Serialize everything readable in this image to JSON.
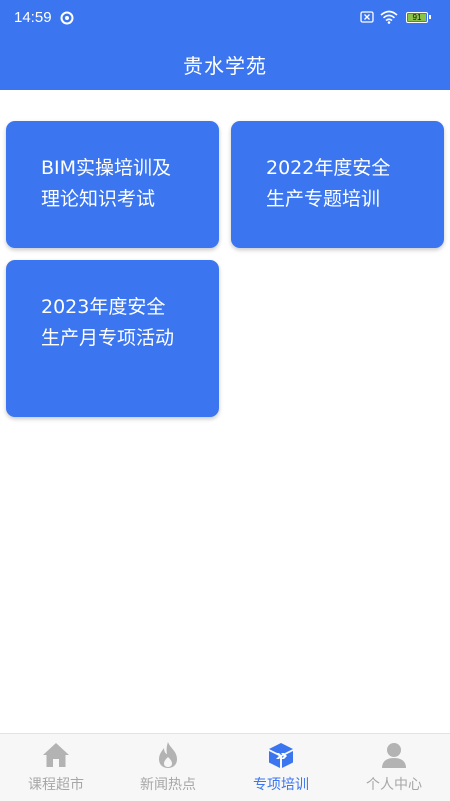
{
  "status_bar": {
    "time": "14:59",
    "battery": "91",
    "icons": [
      "sync-icon",
      "sim-off-icon",
      "wifi-icon",
      "battery-icon"
    ]
  },
  "header": {
    "title": "贵水学苑"
  },
  "cards": [
    {
      "label": "BIM实操培训及理论知识考试"
    },
    {
      "label": "2022年度安全生产专题培训"
    },
    {
      "label": "2023年度安全生产月专项活动"
    }
  ],
  "bottom_nav": [
    {
      "label": "课程超市",
      "icon": "home-icon",
      "active": false
    },
    {
      "label": "新闻热点",
      "icon": "flame-icon",
      "active": false
    },
    {
      "label": "专项培训",
      "icon": "training-box-icon",
      "active": true
    },
    {
      "label": "个人中心",
      "icon": "person-icon",
      "active": false
    }
  ],
  "colors": {
    "primary": "#3b76f0",
    "nav_inactive": "#a7a7a7",
    "nav_background": "#f7f7f7"
  }
}
